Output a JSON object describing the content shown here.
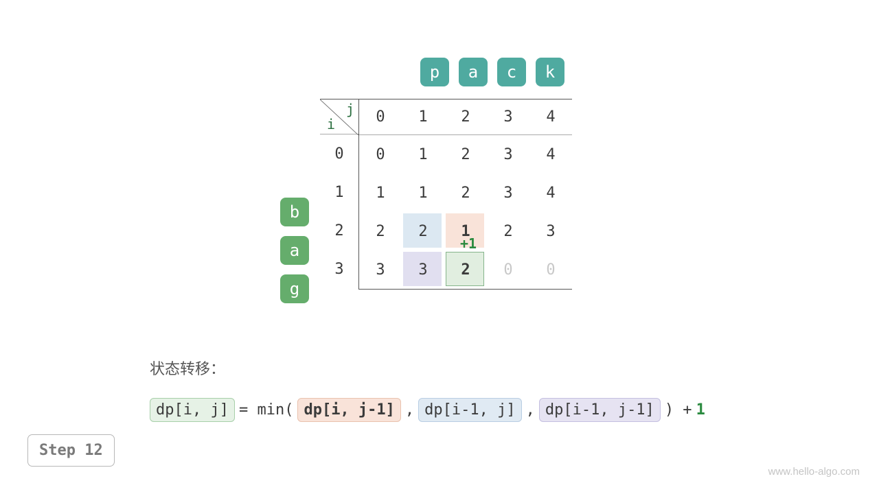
{
  "target_chars": [
    "p",
    "a",
    "c",
    "k"
  ],
  "source_chars": [
    "b",
    "a",
    "g"
  ],
  "axis": {
    "i": "i",
    "j": "j"
  },
  "column_headers": [
    "0",
    "1",
    "2",
    "3",
    "4"
  ],
  "row_indices": [
    "0",
    "1",
    "2",
    "3"
  ],
  "chart_data": {
    "type": "table",
    "title": "Edit distance DP table (bag → pack)",
    "xlabel": "j",
    "ylabel": "i",
    "categories": [
      "0",
      "1",
      "2",
      "3",
      "4"
    ],
    "rows": [
      "0",
      "1",
      "2",
      "3"
    ],
    "grid": [
      [
        "0",
        "1",
        "2",
        "3",
        "4"
      ],
      [
        "1",
        "1",
        "2",
        "3",
        "4"
      ],
      [
        "2",
        "2",
        "1",
        "2",
        "3"
      ],
      [
        "3",
        "3",
        "2",
        "0",
        "0"
      ]
    ],
    "current_cell": {
      "i": 3,
      "j": 2,
      "value": "2"
    },
    "source_cells": [
      {
        "i": 2,
        "j": 1,
        "role": "dp[i-1,j-1]",
        "value": "2"
      },
      {
        "i": 2,
        "j": 2,
        "role": "dp[i-1,j]",
        "value": "1"
      },
      {
        "i": 3,
        "j": 1,
        "role": "dp[i,j-1]",
        "value": "3"
      }
    ],
    "faded_cells": [
      {
        "i": 3,
        "j": 3,
        "value": "0"
      },
      {
        "i": 3,
        "j": 4,
        "value": "0"
      }
    ],
    "increment_label": "+1"
  },
  "plus1": "+1",
  "section_title": "状态转移：",
  "formula": {
    "lhs": "dp[i, j]",
    "eq": " = min( ",
    "a": "dp[i, j-1]",
    "b": "dp[i-1, j]",
    "c": "dp[i-1, j-1]",
    "close": " ) + ",
    "inc": "1",
    "comma": " , "
  },
  "step_label": "Step 12",
  "watermark": "www.hello-algo.com"
}
